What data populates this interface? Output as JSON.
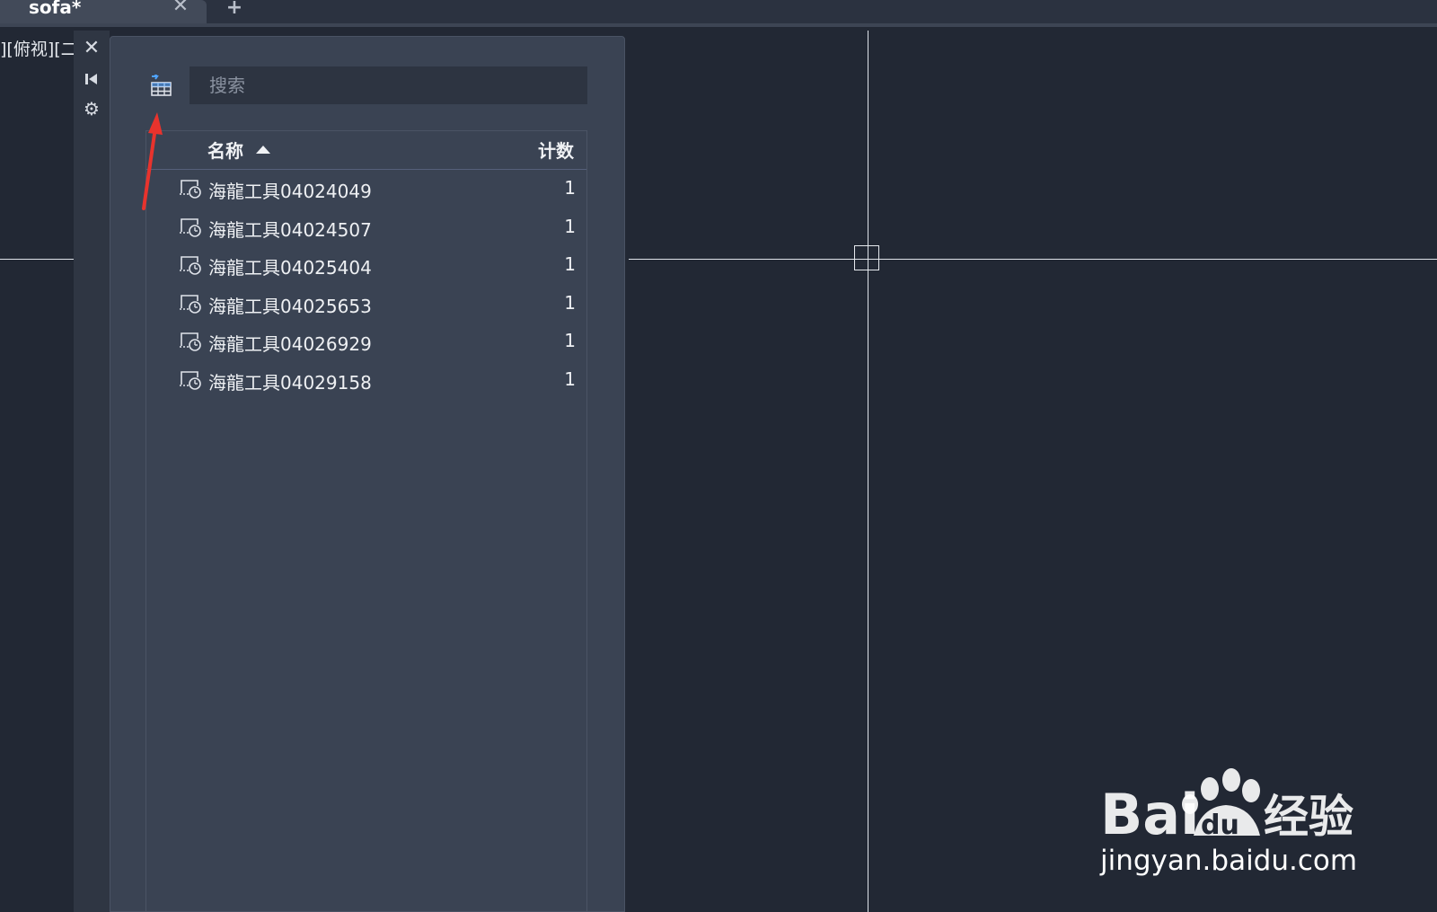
{
  "file_tab": {
    "title": "sofa*",
    "close_glyph": "✕"
  },
  "new_tab_glyph": "+",
  "viewport": {
    "label": "][俯视][二"
  },
  "palette_strip": {
    "close_glyph": "✕",
    "settings_glyph": "⚙"
  },
  "palette": {
    "search": {
      "placeholder": "搜索",
      "value": ""
    },
    "columns": {
      "name": "名称",
      "count": "计数"
    },
    "rows": [
      {
        "name": "海龍工具04024049",
        "count": "1"
      },
      {
        "name": "海龍工具04024507",
        "count": "1"
      },
      {
        "name": "海龍工具04025404",
        "count": "1"
      },
      {
        "name": "海龍工具04025653",
        "count": "1"
      },
      {
        "name": "海龍工具04026929",
        "count": "1"
      },
      {
        "name": "海龍工具04029158",
        "count": "1"
      }
    ]
  },
  "watermark": {
    "brand": "Baidu 经验",
    "url": "jingyan.baidu.com"
  },
  "colors": {
    "canvas": "#222834",
    "panel": "#3a4353",
    "annotation": "#e8332d"
  }
}
